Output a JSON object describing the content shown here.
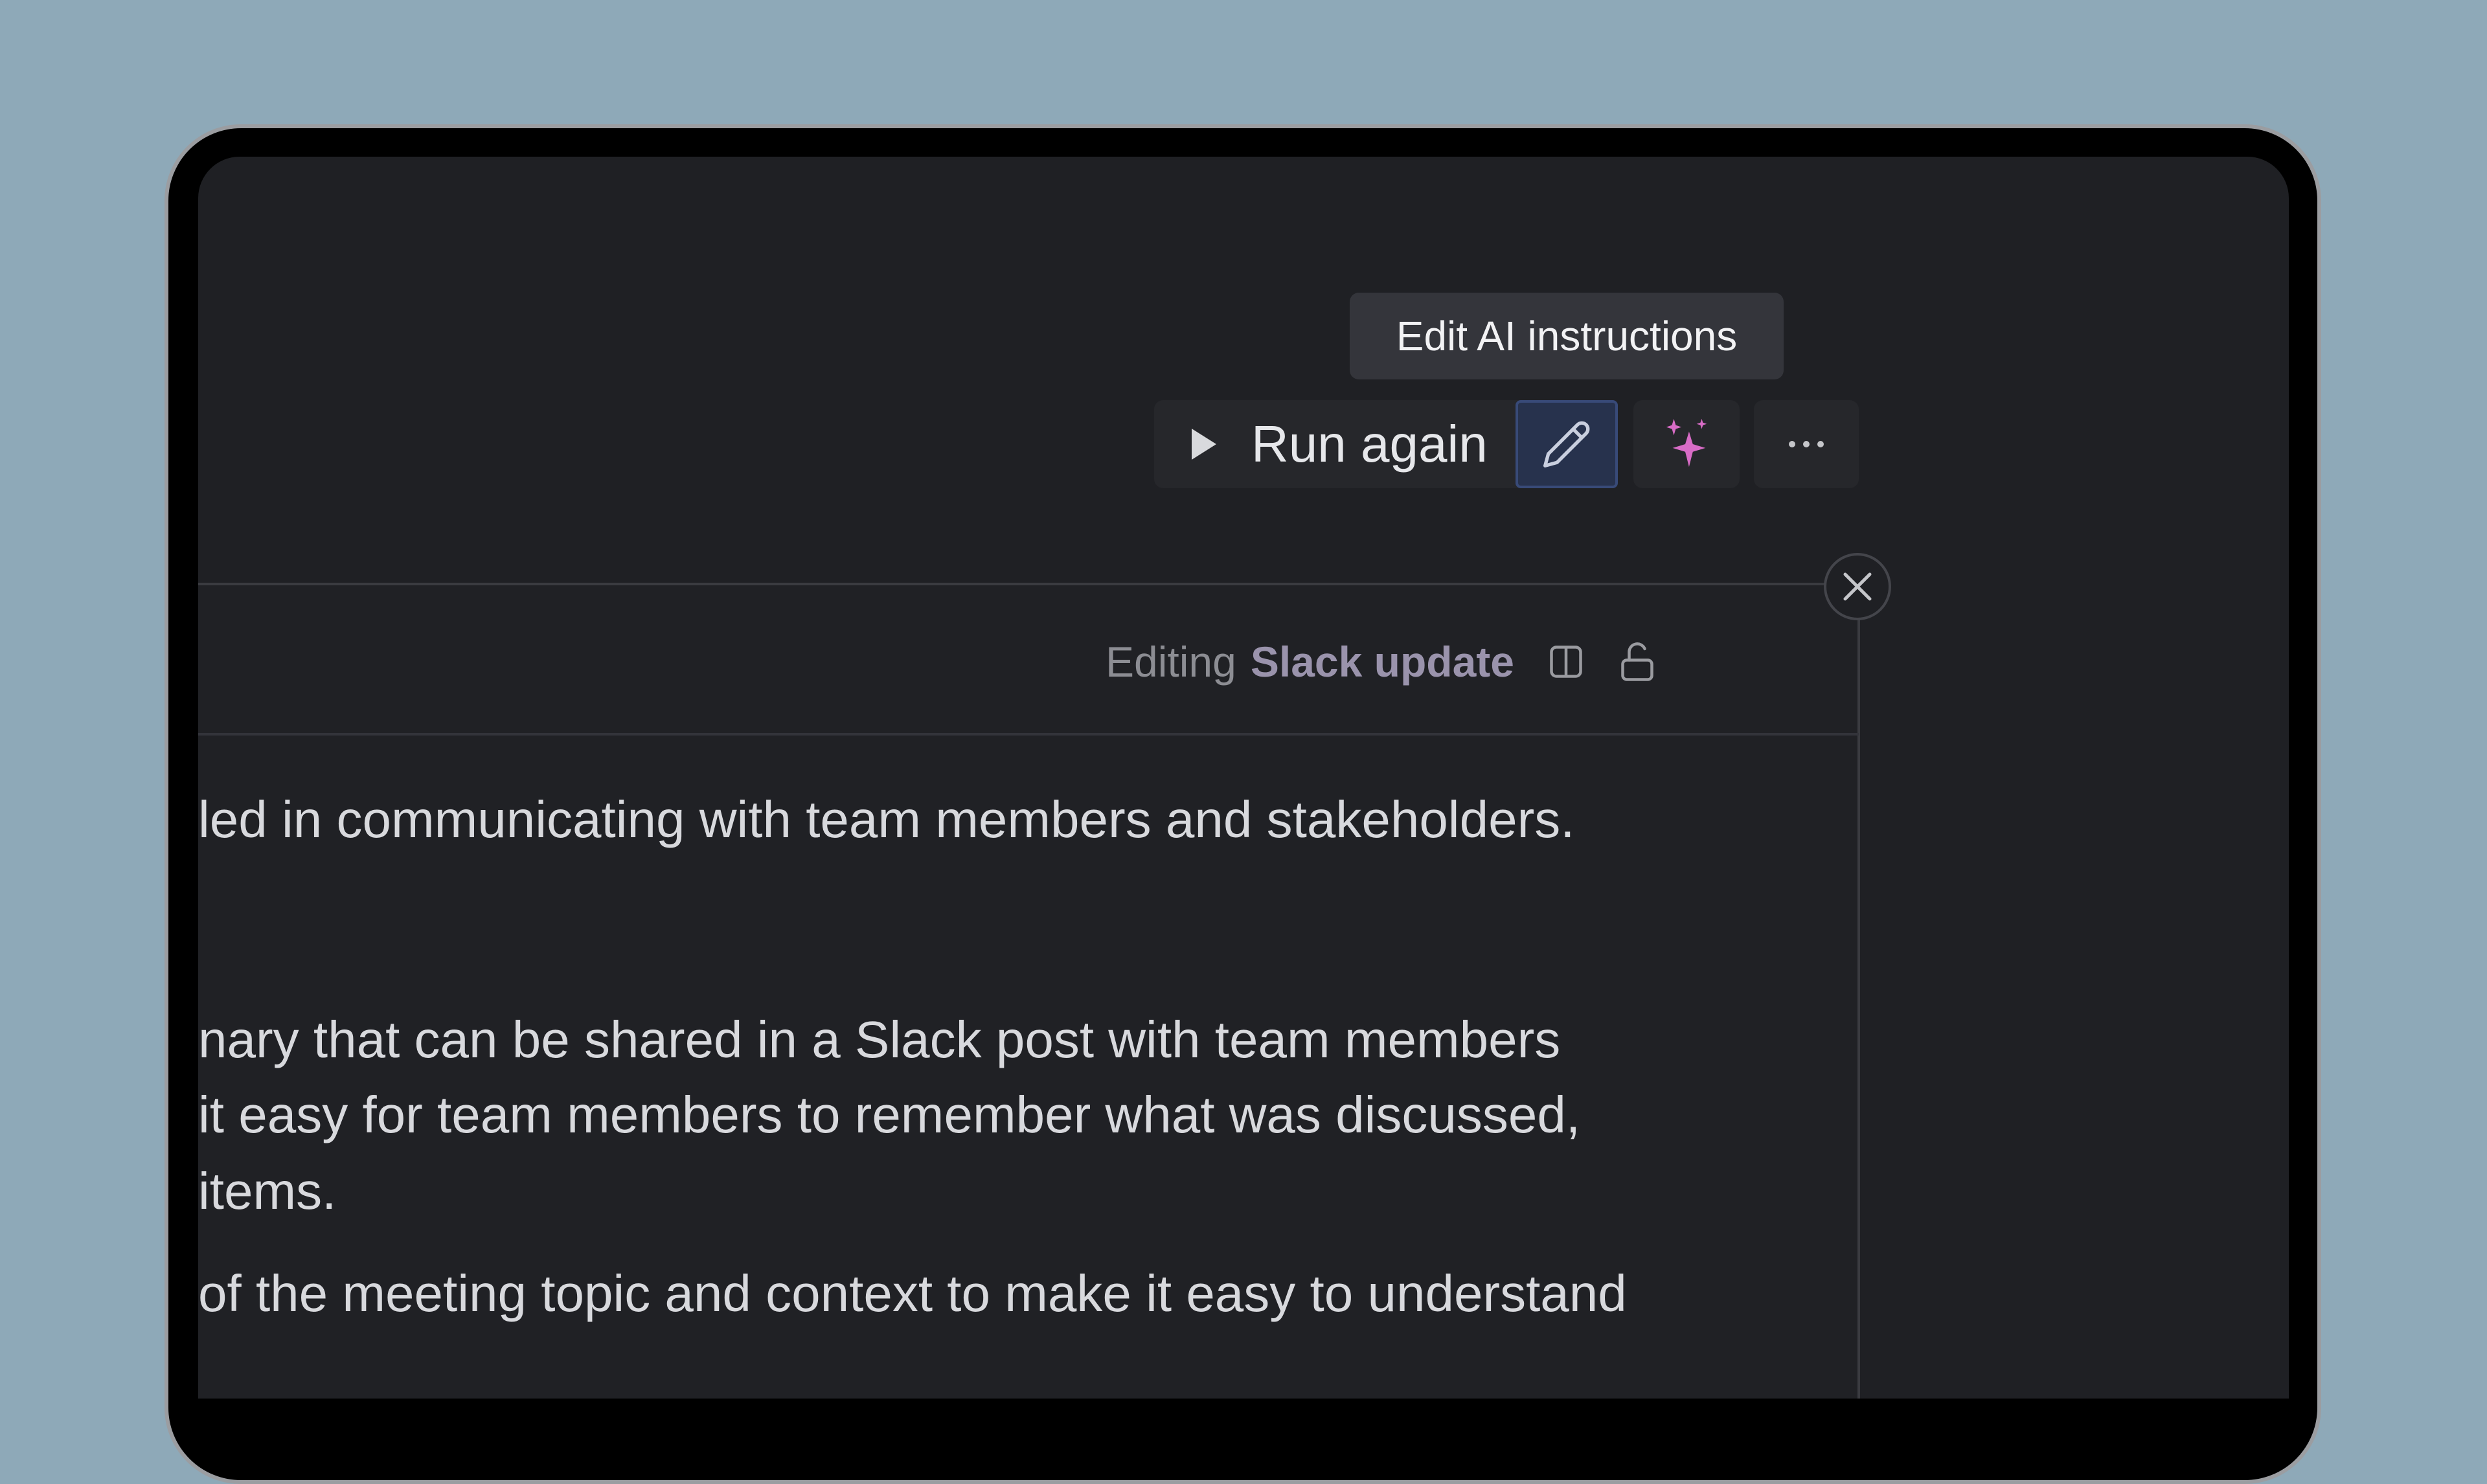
{
  "tooltip": {
    "text": "Edit AI instructions"
  },
  "toolbar": {
    "run_label": "Run again",
    "run_icon": "play-icon",
    "edit_icon": "pencil-icon",
    "ai_icon": "sparkles-icon",
    "more_icon": "ellipsis-icon",
    "ai_color": "#d86cc6",
    "edit_active_bg": "#27324d"
  },
  "panel": {
    "editing_prefix": "Editing",
    "document_name": "Slack update",
    "split_icon": "split-view-icon",
    "lock_icon": "unlock-icon",
    "close_icon": "close-icon"
  },
  "content": {
    "lines": [
      "led in communicating with team members and stakeholders.",
      "nary that can be shared in a Slack post with team members",
      " it easy for team members to remember what was discussed,",
      " items.",
      "of the meeting topic and context to make it easy to understand"
    ]
  }
}
